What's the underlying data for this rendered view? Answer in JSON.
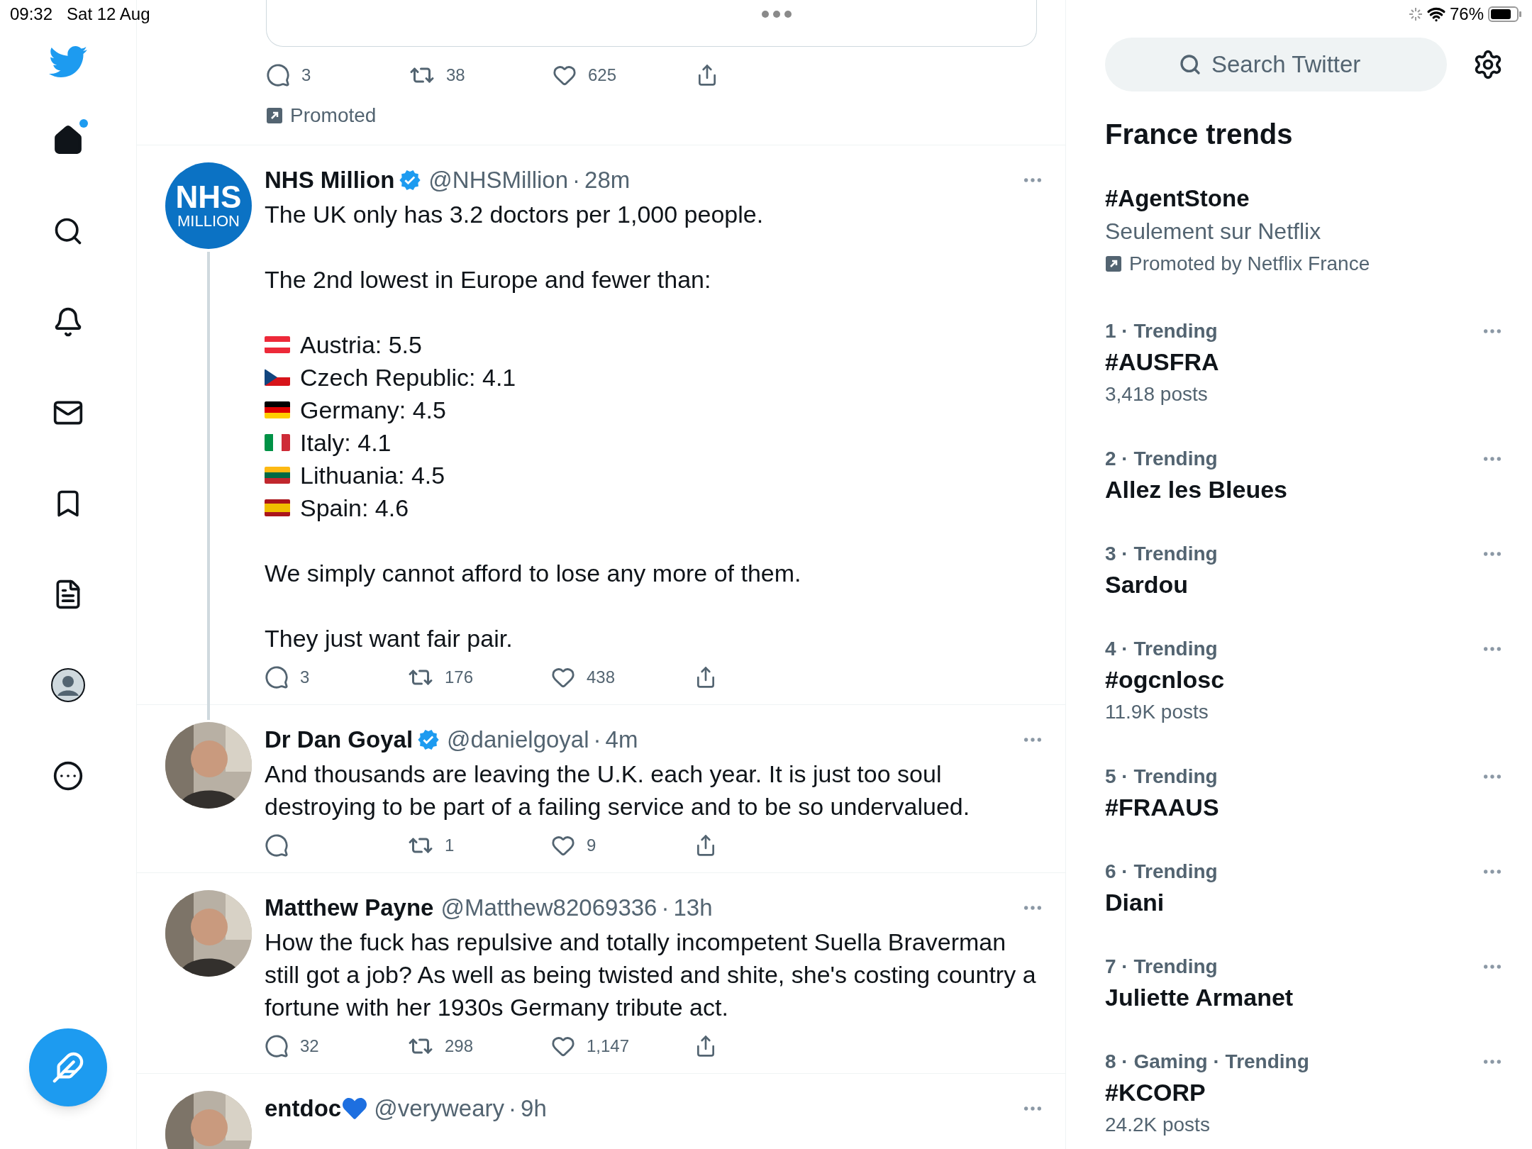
{
  "status_bar": {
    "time": "09:32",
    "date": "Sat 12 Aug",
    "battery": "76%"
  },
  "nav": {
    "items": [
      {
        "kind": "home",
        "selected": true,
        "dot": true
      },
      {
        "kind": "search",
        "selected": false,
        "dot": false
      },
      {
        "kind": "notifications",
        "selected": false,
        "dot": false
      },
      {
        "kind": "messages",
        "selected": false,
        "dot": false
      },
      {
        "kind": "bookmarks",
        "selected": false,
        "dot": false
      },
      {
        "kind": "lists",
        "selected": false,
        "dot": false
      },
      {
        "kind": "profile",
        "selected": false,
        "dot": false
      },
      {
        "kind": "more",
        "selected": false,
        "dot": false
      }
    ]
  },
  "promoted_tweet": {
    "actions": {
      "replies": "3",
      "retweets": "38",
      "likes": "625"
    },
    "label": "Promoted"
  },
  "tweets": [
    {
      "name": "NHS Million",
      "verified": true,
      "heart_emoji": false,
      "handle": "@NHSMillion",
      "separator": "·",
      "time": "28m",
      "thread": true,
      "avatar": {
        "kind": "logo",
        "line1": "NHS",
        "line2": "MILLION"
      },
      "body": [
        {
          "kind": "text",
          "text": "The UK only has 3.2 doctors per 1,000 people."
        },
        {
          "kind": "gap"
        },
        {
          "kind": "text",
          "text": "The 2nd lowest in Europe and fewer than:"
        },
        {
          "kind": "gap"
        },
        {
          "kind": "flag_h",
          "stripes": [
            {
              "color": "#ed2939"
            },
            {
              "color": "#ffffff"
            },
            {
              "color": "#ed2939"
            }
          ],
          "text": "Austria: 5.5"
        },
        {
          "kind": "flag_czech",
          "stripes": [
            {
              "color": "#ffffff"
            },
            {
              "color": "#d7141a"
            },
            {
              "color": "#11457e"
            }
          ],
          "text": "Czech Republic: 4.1"
        },
        {
          "kind": "flag_h",
          "stripes": [
            {
              "color": "#000000"
            },
            {
              "color": "#dd0000"
            },
            {
              "color": "#ffce00"
            }
          ],
          "text": "Germany: 4.5"
        },
        {
          "kind": "flag_v",
          "stripes": [
            {
              "color": "#009246"
            },
            {
              "color": "#ffffff"
            },
            {
              "color": "#ce2b37"
            }
          ],
          "text": "Italy: 4.1"
        },
        {
          "kind": "flag_h",
          "stripes": [
            {
              "color": "#fdb913"
            },
            {
              "color": "#006a44"
            },
            {
              "color": "#c1272d"
            }
          ],
          "text": "Lithuania: 4.5"
        },
        {
          "kind": "flag_spain",
          "stripes": [
            {
              "color": "#aa151b"
            },
            {
              "color": "#f1bf00"
            },
            {
              "color": "#aa151b"
            }
          ],
          "text": "Spain: 4.6"
        },
        {
          "kind": "gap"
        },
        {
          "kind": "text",
          "text": "We simply cannot afford to lose any more of them."
        },
        {
          "kind": "gap"
        },
        {
          "kind": "text",
          "text": "They just want fair pair."
        }
      ],
      "actions": {
        "replies": "3",
        "retweets": "176",
        "likes": "438"
      }
    },
    {
      "name": "Dr Dan Goyal",
      "verified": true,
      "heart_emoji": false,
      "handle": "@danielgoyal",
      "separator": "·",
      "time": "4m",
      "thread": false,
      "body": [
        {
          "kind": "text",
          "text": "And thousands are leaving the U.K. each year. It is just too soul destroying to be part of a failing service and to be so undervalued."
        }
      ],
      "actions": {
        "retweets": "1",
        "likes": "9"
      }
    },
    {
      "name": "Matthew Payne",
      "verified": false,
      "heart_emoji": false,
      "handle": "@Matthew82069336",
      "separator": "·",
      "time": "13h",
      "thread": false,
      "body": [
        {
          "kind": "text",
          "text": "How the fuck has repulsive and totally incompetent Suella Braverman still got a job? As well as being twisted and shite, she's costing country a fortune with her 1930s Germany tribute act."
        }
      ],
      "actions": {
        "replies": "32",
        "retweets": "298",
        "likes": "1,147"
      }
    },
    {
      "name": "entdoc",
      "verified": false,
      "heart_emoji": true,
      "handle": "@veryweary",
      "separator": "·",
      "time": "9h",
      "thread": false
    }
  ],
  "sidebar": {
    "search": {
      "placeholder": "Search Twitter"
    },
    "title": "France trends",
    "promoted_trend": {
      "name": "#AgentStone",
      "subtitle": "Seulement sur Netflix",
      "promoted_by": "Promoted by Netflix France"
    },
    "trends": [
      {
        "meta": "1 · Trending",
        "name": "#AUSFRA",
        "posts": "3,418 posts"
      },
      {
        "meta": "2 · Trending",
        "name": "Allez les Bleues"
      },
      {
        "meta": "3 · Trending",
        "name": "Sardou"
      },
      {
        "meta": "4 · Trending",
        "name": "#ogcnlosc",
        "posts": "11.9K posts"
      },
      {
        "meta": "5 · Trending",
        "name": "#FRAAUS"
      },
      {
        "meta": "6 · Trending",
        "name": "Diani"
      },
      {
        "meta": "7 · Trending",
        "name": "Juliette Armanet"
      },
      {
        "meta": "8 · Gaming · Trending",
        "name": "#KCORP",
        "posts": "24.2K posts"
      }
    ]
  }
}
